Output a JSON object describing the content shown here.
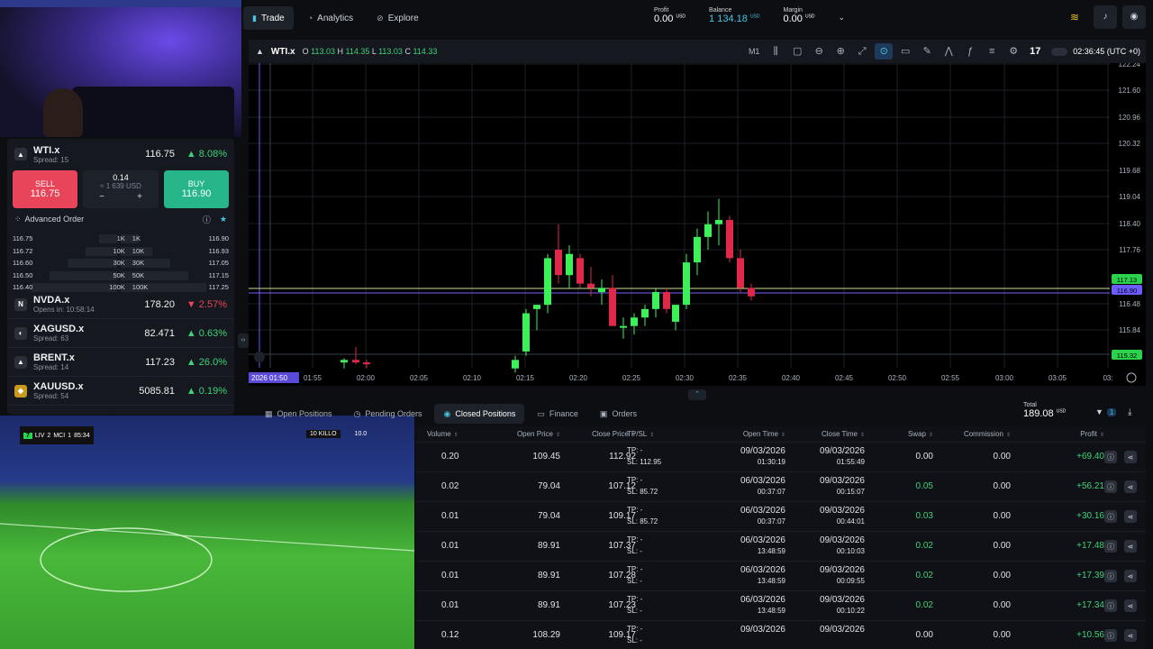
{
  "nav": {
    "tabs": [
      {
        "label": "Trade",
        "icon": "chart-icon"
      },
      {
        "label": "Analytics",
        "icon": "analytics-icon"
      },
      {
        "label": "Explore",
        "icon": "compass-icon"
      }
    ],
    "profit_label": "Profit",
    "profit_value": "0.00",
    "profit_unit": "USD",
    "balance_label": "Balance",
    "balance_value": "1 134.18",
    "balance_unit": "USD",
    "margin_label": "Margin",
    "margin_value": "0.00",
    "margin_unit": "USD"
  },
  "quote": {
    "symbol": "WTI.x",
    "spread": "Spread: 15",
    "price": "116.75",
    "change": "8.08%",
    "sell_label": "SELL",
    "sell_price": "116.75",
    "buy_label": "BUY",
    "buy_price": "116.90",
    "volume": "0.14",
    "volume_usd": "≈ 1 639 USD",
    "minus": "−",
    "plus": "+",
    "advanced_order": "Advanced Order",
    "depth": [
      {
        "bid": "116.75",
        "bid_vol": "1K",
        "ask_vol": "1K",
        "ask": "116.90"
      },
      {
        "bid": "116.72",
        "bid_vol": "10K",
        "ask_vol": "10K",
        "ask": "116.93"
      },
      {
        "bid": "116.60",
        "bid_vol": "30K",
        "ask_vol": "30K",
        "ask": "117.05"
      },
      {
        "bid": "116.50",
        "bid_vol": "50K",
        "ask_vol": "50K",
        "ask": "117.15"
      },
      {
        "bid": "116.40",
        "bid_vol": "100K",
        "ask_vol": "100K",
        "ask": "117.25"
      }
    ]
  },
  "watchlist": [
    {
      "logo": "N",
      "name": "NVDA.x",
      "sub": "Opens in: 10:58:14",
      "price": "178.20",
      "change": "2.57%",
      "dir": "down"
    },
    {
      "logo": "◐",
      "name": "XAGUSD.x",
      "sub": "Spread: 63",
      "price": "82.471",
      "change": "0.63%",
      "dir": "up"
    },
    {
      "logo": "▲",
      "name": "BRENT.x",
      "sub": "Spread: 14",
      "price": "117.23",
      "change": "26.0%",
      "dir": "up"
    },
    {
      "logo": "◆",
      "name": "XAUUSD.x",
      "sub": "Spread: 54",
      "price": "5085.81",
      "change": "0.19%",
      "dir": "up"
    }
  ],
  "chart": {
    "symbol": "WTI.x",
    "ohlc": {
      "o_label": "O",
      "o": "113.03",
      "h_label": "H",
      "h": "114.35",
      "l_label": "L",
      "l": "113.03",
      "c_label": "C",
      "c": "114.33"
    },
    "timeframe": "M1",
    "clock": "02:36:45 (UTC +0)",
    "cursor_time": "2026 01:50",
    "y_ticks": [
      "122.24",
      "121.60",
      "120.96",
      "120.32",
      "119.68",
      "119.04",
      "118.40",
      "117.76",
      "116.48",
      "115.84"
    ],
    "price_tags": [
      "117.13",
      "116.90",
      "115.32"
    ],
    "x_ticks": [
      "01:55",
      "02:00",
      "02:05",
      "02:10",
      "02:15",
      "02:20",
      "02:25",
      "02:30",
      "02:35",
      "02:40",
      "02:45",
      "02:50",
      "02:55",
      "03:00",
      "03:05",
      "03:"
    ]
  },
  "chart_data": {
    "type": "candlestick",
    "y_range": [
      115.2,
      122.3
    ],
    "candles": [
      {
        "t": "02:00",
        "o": 115.24,
        "h": 115.34,
        "l": 115.1,
        "c": 115.3
      },
      {
        "t": "02:00.5",
        "o": 115.3,
        "h": 115.6,
        "l": 115.2,
        "c": 115.24
      },
      {
        "t": "02:01",
        "o": 115.24,
        "h": 115.3,
        "l": 115.1,
        "c": 115.2
      },
      {
        "t": "02:13",
        "o": 115.1,
        "h": 115.4,
        "l": 115.0,
        "c": 115.3
      },
      {
        "t": "02:14",
        "o": 115.5,
        "h": 116.5,
        "l": 115.4,
        "c": 116.4
      },
      {
        "t": "02:15",
        "o": 116.5,
        "h": 116.6,
        "l": 116.0,
        "c": 116.6
      },
      {
        "t": "02:16",
        "o": 116.6,
        "h": 117.8,
        "l": 116.4,
        "c": 117.7
      },
      {
        "t": "02:17",
        "o": 117.9,
        "h": 118.5,
        "l": 117.1,
        "c": 117.3
      },
      {
        "t": "02:18",
        "o": 117.3,
        "h": 118.0,
        "l": 117.0,
        "c": 117.8
      },
      {
        "t": "02:19",
        "o": 117.7,
        "h": 117.8,
        "l": 117.0,
        "c": 117.1
      },
      {
        "t": "02:20",
        "o": 117.1,
        "h": 117.5,
        "l": 116.8,
        "c": 117.0
      },
      {
        "t": "02:21",
        "o": 116.9,
        "h": 117.2,
        "l": 116.6,
        "c": 117.0
      },
      {
        "t": "02:22",
        "o": 117.0,
        "h": 117.3,
        "l": 116.1,
        "c": 116.1
      },
      {
        "t": "02:23",
        "o": 116.1,
        "h": 116.3,
        "l": 115.8,
        "c": 116.1
      },
      {
        "t": "02:24",
        "o": 116.1,
        "h": 116.4,
        "l": 115.9,
        "c": 116.3
      },
      {
        "t": "02:25",
        "o": 116.3,
        "h": 116.6,
        "l": 116.1,
        "c": 116.5
      },
      {
        "t": "02:26",
        "o": 116.5,
        "h": 117.0,
        "l": 116.3,
        "c": 116.9
      },
      {
        "t": "02:27",
        "o": 116.9,
        "h": 117.0,
        "l": 116.4,
        "c": 116.5
      },
      {
        "t": "02:28",
        "o": 116.2,
        "h": 116.6,
        "l": 116.0,
        "c": 116.6
      },
      {
        "t": "02:29",
        "o": 116.6,
        "h": 117.8,
        "l": 116.5,
        "c": 117.6
      },
      {
        "t": "02:30",
        "o": 117.6,
        "h": 118.4,
        "l": 117.3,
        "c": 118.2
      },
      {
        "t": "02:31",
        "o": 118.2,
        "h": 118.8,
        "l": 117.9,
        "c": 118.5
      },
      {
        "t": "02:32",
        "o": 118.5,
        "h": 119.1,
        "l": 118.0,
        "c": 118.6
      },
      {
        "t": "02:33",
        "o": 118.6,
        "h": 118.7,
        "l": 117.6,
        "c": 117.7
      },
      {
        "t": "02:34",
        "o": 117.7,
        "h": 117.9,
        "l": 116.9,
        "c": 117.0
      },
      {
        "t": "02:35",
        "o": 117.0,
        "h": 117.1,
        "l": 116.7,
        "c": 116.8
      }
    ]
  },
  "bottom": {
    "tabs": [
      "Open Positions",
      "Pending Orders",
      "Closed Positions",
      "Finance",
      "Orders"
    ],
    "total_label": "Total",
    "total_value": "189.08",
    "total_unit": "USD",
    "filter_count": "1",
    "columns": [
      "Volume",
      "Open Price",
      "Close Price",
      "TP/SL",
      "Open Time",
      "Close Time",
      "Swap",
      "Commission",
      "Profit"
    ],
    "rows": [
      {
        "volume": "0.20",
        "open": "109.45",
        "close": "112.92",
        "tp": "TP: -",
        "sl": "SL: 112.95",
        "od": "09/03/2026",
        "ot": "01:30:19",
        "cd": "09/03/2026",
        "ct": "01:55:49",
        "swap": "0.00",
        "comm": "0.00",
        "profit": "+69.40"
      },
      {
        "volume": "0.02",
        "open": "79.04",
        "close": "107.12",
        "tp": "TP: -",
        "sl": "SL: 85.72",
        "od": "06/03/2026",
        "ot": "00:37:07",
        "cd": "09/03/2026",
        "ct": "00:15:07",
        "swap": "0.05",
        "comm": "0.00",
        "profit": "+56.21"
      },
      {
        "volume": "0.01",
        "open": "79.04",
        "close": "109.17",
        "tp": "TP: -",
        "sl": "SL: 85.72",
        "od": "06/03/2026",
        "ot": "00:37:07",
        "cd": "09/03/2026",
        "ct": "00:44:01",
        "swap": "0.03",
        "comm": "0.00",
        "profit": "+30.16"
      },
      {
        "volume": "0.01",
        "open": "89.91",
        "close": "107.37",
        "tp": "TP: -",
        "sl": "SL: -",
        "od": "06/03/2026",
        "ot": "13:48:59",
        "cd": "09/03/2026",
        "ct": "00:10:03",
        "swap": "0.02",
        "comm": "0.00",
        "profit": "+17.48"
      },
      {
        "volume": "0.01",
        "open": "89.91",
        "close": "107.28",
        "tp": "TP: -",
        "sl": "SL: -",
        "od": "06/03/2026",
        "ot": "13:48:59",
        "cd": "09/03/2026",
        "ct": "00:09:55",
        "swap": "0.02",
        "comm": "0.00",
        "profit": "+17.39"
      },
      {
        "volume": "0.01",
        "open": "89.91",
        "close": "107.23",
        "tp": "TP: -",
        "sl": "SL: -",
        "od": "06/03/2026",
        "ot": "13:48:59",
        "cd": "09/03/2026",
        "ct": "00:10:22",
        "swap": "0.02",
        "comm": "0.00",
        "profit": "+17.34"
      },
      {
        "volume": "0.12",
        "open": "108.29",
        "close": "109.17",
        "tp": "TP: -",
        "sl": "SL: -",
        "od": "09/03/2026",
        "ot": "",
        "cd": "09/03/2026",
        "ct": "",
        "swap": "0.00",
        "comm": "0.00",
        "profit": "+10.56"
      }
    ]
  },
  "game": {
    "team1": "LIV",
    "team2": "MCI",
    "score1": "2",
    "score2": "1",
    "time": "85:34",
    "player_tag": "10 KILLO",
    "player_value": "10.0"
  },
  "colors": {
    "up": "#3fd27a",
    "down": "#e8445a",
    "accent": "#4ac3e0",
    "candle_up": "#3df05a",
    "candle_down": "#e0284a"
  }
}
